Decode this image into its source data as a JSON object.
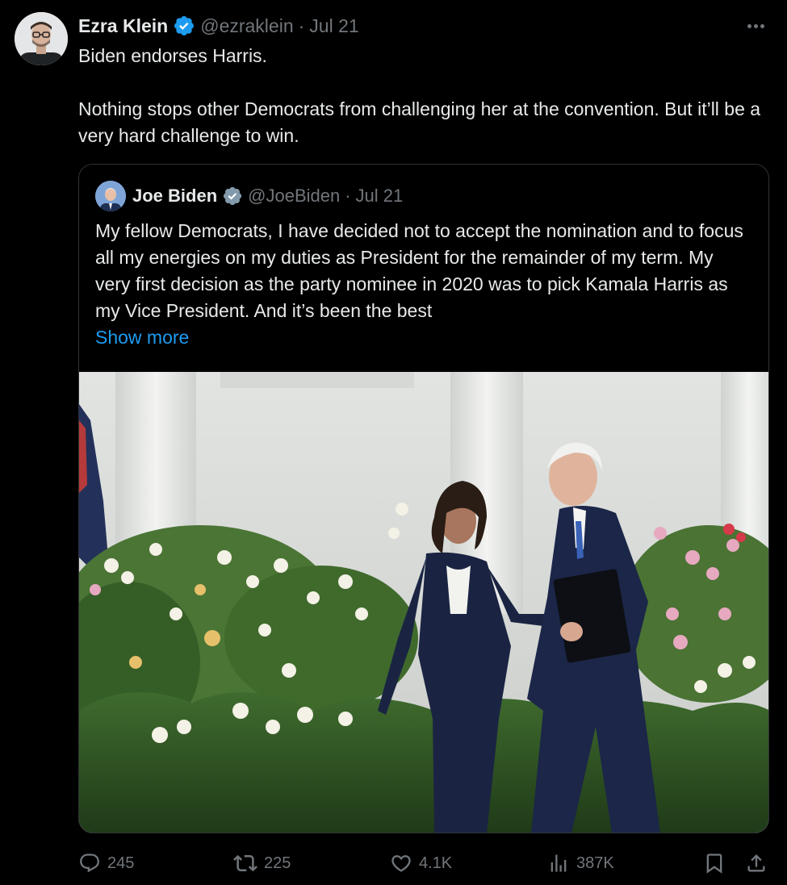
{
  "tweet": {
    "author_name": "Ezra Klein",
    "handle": "@ezraklein",
    "separator": "·",
    "date": "Jul 21",
    "text_line1": "Biden endorses Harris.",
    "text_line2": "Nothing stops other Democrats from challenging her at the convention. But it’ll be a very hard challenge to win."
  },
  "quoted": {
    "author_name": "Joe Biden",
    "handle": "@JoeBiden",
    "separator": "·",
    "date": "Jul 21",
    "text": "My fellow Democrats, I have decided not to accept the nomination and to focus all my energies on my duties as President for the remainder of my term. My very first decision as the party nominee in 2020 was to pick Kamala Harris as my Vice President. And it’s been the best",
    "show_more": "Show more"
  },
  "actions": {
    "replies": "245",
    "reposts": "225",
    "likes": "4.1K",
    "views": "387K"
  },
  "colors": {
    "background": "#000000",
    "text": "#e7e9ea",
    "muted": "#71767b",
    "link": "#1d9bf0",
    "verified_blue": "#1d9bf0",
    "verified_gray": "#829aab"
  },
  "icons": {
    "more": "more-dots-icon",
    "reply": "reply-icon",
    "repost": "repost-icon",
    "like": "heart-icon",
    "views": "views-chart-icon",
    "bookmark": "bookmark-icon",
    "share": "share-icon"
  }
}
